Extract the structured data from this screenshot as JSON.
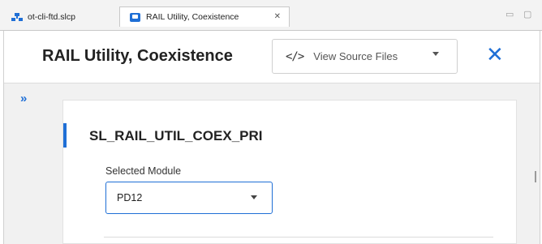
{
  "tabs": [
    {
      "label": "ot-cli-ftd.slcp"
    },
    {
      "label": "RAIL Utility, Coexistence",
      "close": "✕"
    }
  ],
  "window_controls": {
    "minimize": "▭",
    "maximize": "▢"
  },
  "header": {
    "title": "RAIL Utility, Coexistence",
    "source_button_label": "View Source Files",
    "close_symbol": "✕"
  },
  "sidebar": {
    "expand_symbol": "»"
  },
  "card": {
    "title": "SL_RAIL_UTIL_COEX_PRI",
    "field_label": "Selected Module",
    "selected_value": "PD12"
  },
  "colors": {
    "accent": "#1f6fd6"
  },
  "icons": [
    "project-icon",
    "component-icon",
    "code-icon",
    "chevron-down-icon",
    "close-icon",
    "expand-icon"
  ]
}
